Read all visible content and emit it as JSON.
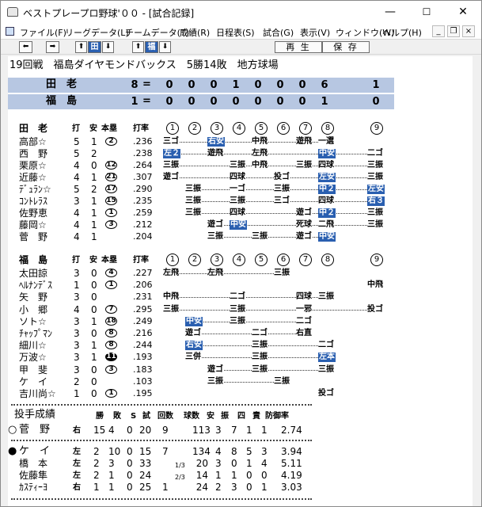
{
  "window": {
    "title": "ベストプレープロ野球'００ - [試合記録]",
    "minimize": "—",
    "maximize": "☐",
    "close": "✕"
  },
  "menu": [
    "ファイル(F)",
    "リーグデータ(L)",
    "チームデータ(T)",
    "成績(R)",
    "日程表(S)",
    "試合(G)",
    "表示(V)",
    "ウィンドウ(W)",
    "ヘルプ(H)"
  ],
  "mdi": {
    "min": "_",
    "restore": "❐",
    "close": "×"
  },
  "toolbar": {
    "team1": "田",
    "team2": "福",
    "play": "再 生",
    "save": "保 存"
  },
  "game": {
    "info": "19回戦　福島ダイヤモンドバックス　5勝14敗　地方球場"
  },
  "scoreboard": [
    {
      "team": "田　老",
      "total": "8",
      "innings": [
        "0",
        "0",
        "0",
        "1",
        "0",
        "0",
        "0",
        "6",
        "1"
      ]
    },
    {
      "team": "福　島",
      "total": "1",
      "innings": [
        "0",
        "0",
        "0",
        "0",
        "0",
        "0",
        "0",
        "1",
        "0"
      ]
    }
  ],
  "headers": {
    "ab": "打",
    "h": "安",
    "hr": "本塁",
    "avg": "打率",
    "inn": [
      "1",
      "2",
      "3",
      "4",
      "5",
      "6",
      "7",
      "8",
      "9"
    ]
  },
  "batting": [
    {
      "team": "田　老",
      "players": [
        {
          "name": "高部☆",
          "ab": "5",
          "h": "1",
          "hr": "2",
          "avg": ".236",
          "r": [
            [
              "三ゴ",
              0
            ],
            [
              "",
              0
            ],
            [
              "右安",
              1
            ],
            [
              "",
              0
            ],
            [
              "中飛",
              0
            ],
            [
              "",
              0
            ],
            [
              "遊飛",
              0
            ],
            [
              "一選",
              0
            ],
            [
              "",
              0
            ]
          ]
        },
        {
          "name": "西　野",
          "ab": "5",
          "h": "2",
          "hr": "",
          "avg": ".238",
          "r": [
            [
              "左２",
              1
            ],
            [
              "",
              0
            ],
            [
              "遊飛",
              0
            ],
            [
              "",
              0
            ],
            [
              "左飛",
              0
            ],
            [
              "",
              0
            ],
            [
              "",
              0
            ],
            [
              "中安",
              1
            ],
            [
              "二ゴ",
              0
            ]
          ]
        },
        {
          "name": "栗原☆",
          "ab": "4",
          "h": "0",
          "hr": "12",
          "avg": ".264",
          "r": [
            [
              "三振",
              0
            ],
            [
              "",
              0
            ],
            [
              "",
              0
            ],
            [
              "三振",
              0
            ],
            [
              "中飛",
              0
            ],
            [
              "",
              0
            ],
            [
              "三振",
              0
            ],
            [
              "四球",
              0
            ],
            [
              "三振",
              0
            ]
          ]
        },
        {
          "name": "近藤☆",
          "ab": "4",
          "h": "1",
          "hr": "21",
          "avg": ".307",
          "r": [
            [
              "遊ゴ",
              0
            ],
            [
              "",
              0
            ],
            [
              "",
              0
            ],
            [
              "四球",
              0
            ],
            [
              "",
              0
            ],
            [
              "投ゴ",
              0
            ],
            [
              "",
              0
            ],
            [
              "左安",
              1
            ],
            [
              "三振",
              0
            ]
          ]
        },
        {
          "name": "ﾃﾞｭﾗﾝ☆",
          "ab": "5",
          "h": "2",
          "hr": "17",
          "avg": ".290",
          "r": [
            [
              "",
              0
            ],
            [
              "三振",
              0
            ],
            [
              "",
              0
            ],
            [
              "一ゴ",
              0
            ],
            [
              "",
              0
            ],
            [
              "三振",
              0
            ],
            [
              "",
              0
            ],
            [
              "中２",
              1
            ],
            [
              "左安",
              1
            ]
          ]
        },
        {
          "name": "ｺﾝﾄﾚﾗｽ",
          "ab": "3",
          "h": "1",
          "hr": "15",
          "avg": ".235",
          "r": [
            [
              "",
              0
            ],
            [
              "三振",
              0
            ],
            [
              "",
              0
            ],
            [
              "三振",
              0
            ],
            [
              "",
              0
            ],
            [
              "三ゴ",
              0
            ],
            [
              "",
              0
            ],
            [
              "四球",
              0
            ],
            [
              "右３",
              1
            ]
          ]
        },
        {
          "name": "佐野恵",
          "ab": "4",
          "h": "1",
          "hr": "1",
          "avg": ".259",
          "r": [
            [
              "",
              0
            ],
            [
              "三振",
              0
            ],
            [
              "",
              0
            ],
            [
              "四球",
              0
            ],
            [
              "",
              0
            ],
            [
              "",
              0
            ],
            [
              "遊ゴ",
              0
            ],
            [
              "中２",
              1
            ],
            [
              "三振",
              0
            ]
          ]
        },
        {
          "name": "藤岡☆",
          "ab": "4",
          "h": "1",
          "hr": "3",
          "avg": ".212",
          "r": [
            [
              "",
              0
            ],
            [
              "",
              0
            ],
            [
              "遊ゴ",
              0
            ],
            [
              "中安",
              1
            ],
            [
              "",
              0
            ],
            [
              "",
              0
            ],
            [
              "死球",
              0
            ],
            [
              "二飛",
              0
            ],
            [
              "三振",
              0
            ]
          ]
        },
        {
          "name": "菅　野",
          "ab": "4",
          "h": "1",
          "hr": "",
          "avg": ".204",
          "r": [
            [
              "",
              0
            ],
            [
              "",
              0
            ],
            [
              "三振",
              0
            ],
            [
              "",
              0
            ],
            [
              "三振",
              0
            ],
            [
              "",
              0
            ],
            [
              "遊ゴ",
              0
            ],
            [
              "中安",
              1
            ],
            [
              "",
              0
            ]
          ]
        }
      ]
    },
    {
      "team": "福　島",
      "players": [
        {
          "name": "太田諒",
          "ab": "3",
          "h": "0",
          "hr": "4",
          "avg": ".227",
          "r": [
            [
              "左飛",
              0
            ],
            [
              "",
              0
            ],
            [
              "左飛",
              0
            ],
            [
              "",
              0
            ],
            [
              "",
              0
            ],
            [
              "三振",
              0
            ],
            [
              "",
              0
            ],
            [
              "",
              0
            ],
            [
              "",
              0
            ]
          ]
        },
        {
          "name": "ﾍﾙﾅﾝﾃﾞｽ",
          "ab": "1",
          "h": "0",
          "hr": "1",
          "avg": ".206",
          "r": [
            [
              "",
              0
            ],
            [
              "",
              0
            ],
            [
              "",
              0
            ],
            [
              "",
              0
            ],
            [
              "",
              0
            ],
            [
              "",
              0
            ],
            [
              "",
              0
            ],
            [
              "",
              0
            ],
            [
              "中飛",
              0
            ]
          ]
        },
        {
          "name": "矢　野",
          "ab": "3",
          "h": "0",
          "hr": "",
          "avg": ".231",
          "r": [
            [
              "中飛",
              0
            ],
            [
              "",
              0
            ],
            [
              "",
              0
            ],
            [
              "二ゴ",
              0
            ],
            [
              "",
              0
            ],
            [
              "",
              0
            ],
            [
              "四球",
              0
            ],
            [
              "三振",
              0
            ],
            [
              "",
              0
            ]
          ]
        },
        {
          "name": "小　郷",
          "ab": "4",
          "h": "0",
          "hr": "7",
          "avg": ".295",
          "r": [
            [
              "三振",
              0
            ],
            [
              "",
              0
            ],
            [
              "",
              0
            ],
            [
              "三振",
              0
            ],
            [
              "",
              0
            ],
            [
              "",
              0
            ],
            [
              "一邪",
              0
            ],
            [
              "",
              0
            ],
            [
              "投ゴ",
              0
            ]
          ]
        },
        {
          "name": "ソト☆",
          "ab": "3",
          "h": "1",
          "hr": "18",
          "avg": ".249",
          "r": [
            [
              "",
              0
            ],
            [
              "中安",
              1
            ],
            [
              "",
              0
            ],
            [
              "三振",
              0
            ],
            [
              "",
              0
            ],
            [
              "",
              0
            ],
            [
              "二ゴ",
              0
            ],
            [
              "",
              0
            ],
            [
              "",
              0
            ]
          ]
        },
        {
          "name": "ﾁｬｯﾌﾟﾏﾝ",
          "ab": "3",
          "h": "0",
          "hr": "8",
          "avg": ".216",
          "r": [
            [
              "",
              0
            ],
            [
              "遊ゴ",
              0
            ],
            [
              "",
              0
            ],
            [
              "",
              0
            ],
            [
              "二ゴ",
              0
            ],
            [
              "",
              0
            ],
            [
              "右直",
              0
            ],
            [
              "",
              0
            ],
            [
              "",
              0
            ]
          ]
        },
        {
          "name": "細川☆",
          "ab": "3",
          "h": "1",
          "hr": "8",
          "avg": ".244",
          "r": [
            [
              "",
              0
            ],
            [
              "右安",
              1
            ],
            [
              "",
              0
            ],
            [
              "",
              0
            ],
            [
              "三振",
              0
            ],
            [
              "",
              0
            ],
            [
              "",
              0
            ],
            [
              "二ゴ",
              0
            ],
            [
              "",
              0
            ]
          ]
        },
        {
          "name": "万波☆",
          "ab": "3",
          "h": "1",
          "hr": "11",
          "avg": ".193",
          "r": [
            [
              "",
              0
            ],
            [
              "三併",
              0
            ],
            [
              "",
              0
            ],
            [
              "",
              0
            ],
            [
              "三振",
              0
            ],
            [
              "",
              0
            ],
            [
              "",
              0
            ],
            [
              "左本",
              1
            ],
            [
              "",
              0
            ]
          ]
        },
        {
          "name": "甲　斐",
          "ab": "3",
          "h": "0",
          "hr": "3",
          "avg": ".183",
          "r": [
            [
              "",
              0
            ],
            [
              "",
              0
            ],
            [
              "遊ゴ",
              0
            ],
            [
              "",
              0
            ],
            [
              "三振",
              0
            ],
            [
              "",
              0
            ],
            [
              "",
              0
            ],
            [
              "三振",
              0
            ],
            [
              "",
              0
            ]
          ]
        },
        {
          "name": "ケ　イ",
          "ab": "2",
          "h": "0",
          "hr": "",
          "avg": ".103",
          "r": [
            [
              "",
              0
            ],
            [
              "",
              0
            ],
            [
              "三振",
              0
            ],
            [
              "",
              0
            ],
            [
              "",
              0
            ],
            [
              "三振",
              0
            ],
            [
              "",
              0
            ],
            [
              "",
              0
            ],
            [
              "",
              0
            ]
          ]
        },
        {
          "name": "吉川尚☆",
          "ab": "1",
          "h": "0",
          "hr": "1",
          "avg": ".195",
          "r": [
            [
              "",
              0
            ],
            [
              "",
              0
            ],
            [
              "",
              0
            ],
            [
              "",
              0
            ],
            [
              "",
              0
            ],
            [
              "",
              0
            ],
            [
              "",
              0
            ],
            [
              "投ゴ",
              0
            ],
            [
              "",
              0
            ]
          ]
        }
      ]
    }
  ],
  "pitching": {
    "title": "投手成績",
    "headers": [
      "勝",
      "敗",
      "S",
      "試",
      "回数",
      "球数",
      "安",
      "振",
      "四",
      "責",
      "防御率"
    ],
    "groups": [
      [
        {
          "mark": "○",
          "name": "菅　野",
          "hand": "右",
          "w": "15",
          "l": "4",
          "s": "0",
          "g": "20",
          "ip": "9",
          "ipf": "",
          "np": "113",
          "h": "3",
          "k": "7",
          "bb": "1",
          "er": "1",
          "era": "2.74"
        }
      ],
      [
        {
          "mark": "●",
          "name": "ケ　イ",
          "hand": "左",
          "w": "2",
          "l": "10",
          "s": "0",
          "g": "15",
          "ip": "7",
          "ipf": "",
          "np": "134",
          "h": "4",
          "k": "8",
          "bb": "5",
          "er": "3",
          "era": "3.94"
        },
        {
          "mark": "",
          "name": "橋　本",
          "hand": "左",
          "w": "2",
          "l": "3",
          "s": "0",
          "g": "33",
          "ip": "",
          "ipf": "1/3",
          "np": "20",
          "h": "3",
          "k": "0",
          "bb": "1",
          "er": "4",
          "era": "5.11"
        },
        {
          "mark": "",
          "name": "佐藤隼",
          "hand": "左",
          "w": "2",
          "l": "1",
          "s": "0",
          "g": "24",
          "ip": "",
          "ipf": "2/3",
          "np": "14",
          "h": "1",
          "k": "1",
          "bb": "0",
          "er": "0",
          "era": "4.19"
        },
        {
          "mark": "",
          "name": "ｶｽﾃｨｰﾖ",
          "hand": "右",
          "w": "1",
          "l": "1",
          "s": "0",
          "g": "25",
          "ip": "1",
          "ipf": "",
          "np": "24",
          "h": "2",
          "k": "3",
          "bb": "0",
          "er": "1",
          "era": "3.03"
        }
      ]
    ]
  },
  "colors": {
    "scoreboard": "#b7c7e2",
    "hit": "#2a5fb0"
  }
}
